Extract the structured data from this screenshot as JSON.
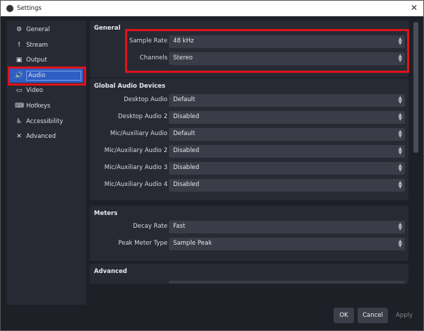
{
  "window": {
    "title": "Settings",
    "close_icon": "close-icon"
  },
  "sidebar": {
    "items": [
      {
        "label": "General",
        "icon": "gear-icon",
        "glyph": "⚙"
      },
      {
        "label": "Stream",
        "icon": "antenna-icon",
        "glyph": "ꝉ"
      },
      {
        "label": "Output",
        "icon": "output-icon",
        "glyph": "▣"
      },
      {
        "label": "Audio",
        "icon": "speaker-icon",
        "glyph": "🔊"
      },
      {
        "label": "Video",
        "icon": "monitor-icon",
        "glyph": "▭"
      },
      {
        "label": "Hotkeys",
        "icon": "keyboard-icon",
        "glyph": "⌨"
      },
      {
        "label": "Accessibility",
        "icon": "accessibility-icon",
        "glyph": "♿"
      },
      {
        "label": "Advanced",
        "icon": "tools-icon",
        "glyph": "✕"
      }
    ],
    "active": "Audio"
  },
  "sections": {
    "general": {
      "title": "General",
      "rows": [
        {
          "label": "Sample Rate",
          "value": "48 kHz"
        },
        {
          "label": "Channels",
          "value": "Stereo"
        }
      ]
    },
    "devices": {
      "title": "Global Audio Devices",
      "rows": [
        {
          "label": "Desktop Audio",
          "value": "Default"
        },
        {
          "label": "Desktop Audio 2",
          "value": "Disabled"
        },
        {
          "label": "Mic/Auxiliary Audio",
          "value": "Default"
        },
        {
          "label": "Mic/Auxiliary Audio 2",
          "value": "Disabled"
        },
        {
          "label": "Mic/Auxiliary Audio 3",
          "value": "Disabled"
        },
        {
          "label": "Mic/Auxiliary Audio 4",
          "value": "Disabled"
        }
      ]
    },
    "meters": {
      "title": "Meters",
      "rows": [
        {
          "label": "Decay Rate",
          "value": "Fast"
        },
        {
          "label": "Peak Meter Type",
          "value": "Sample Peak"
        }
      ]
    },
    "advanced": {
      "title": "Advanced"
    }
  },
  "buttons": {
    "ok": "OK",
    "cancel": "Cancel",
    "apply": "Apply"
  },
  "colors": {
    "highlight": "#e0121b",
    "selection": "#2f5fc4",
    "background": "#1e2028"
  }
}
